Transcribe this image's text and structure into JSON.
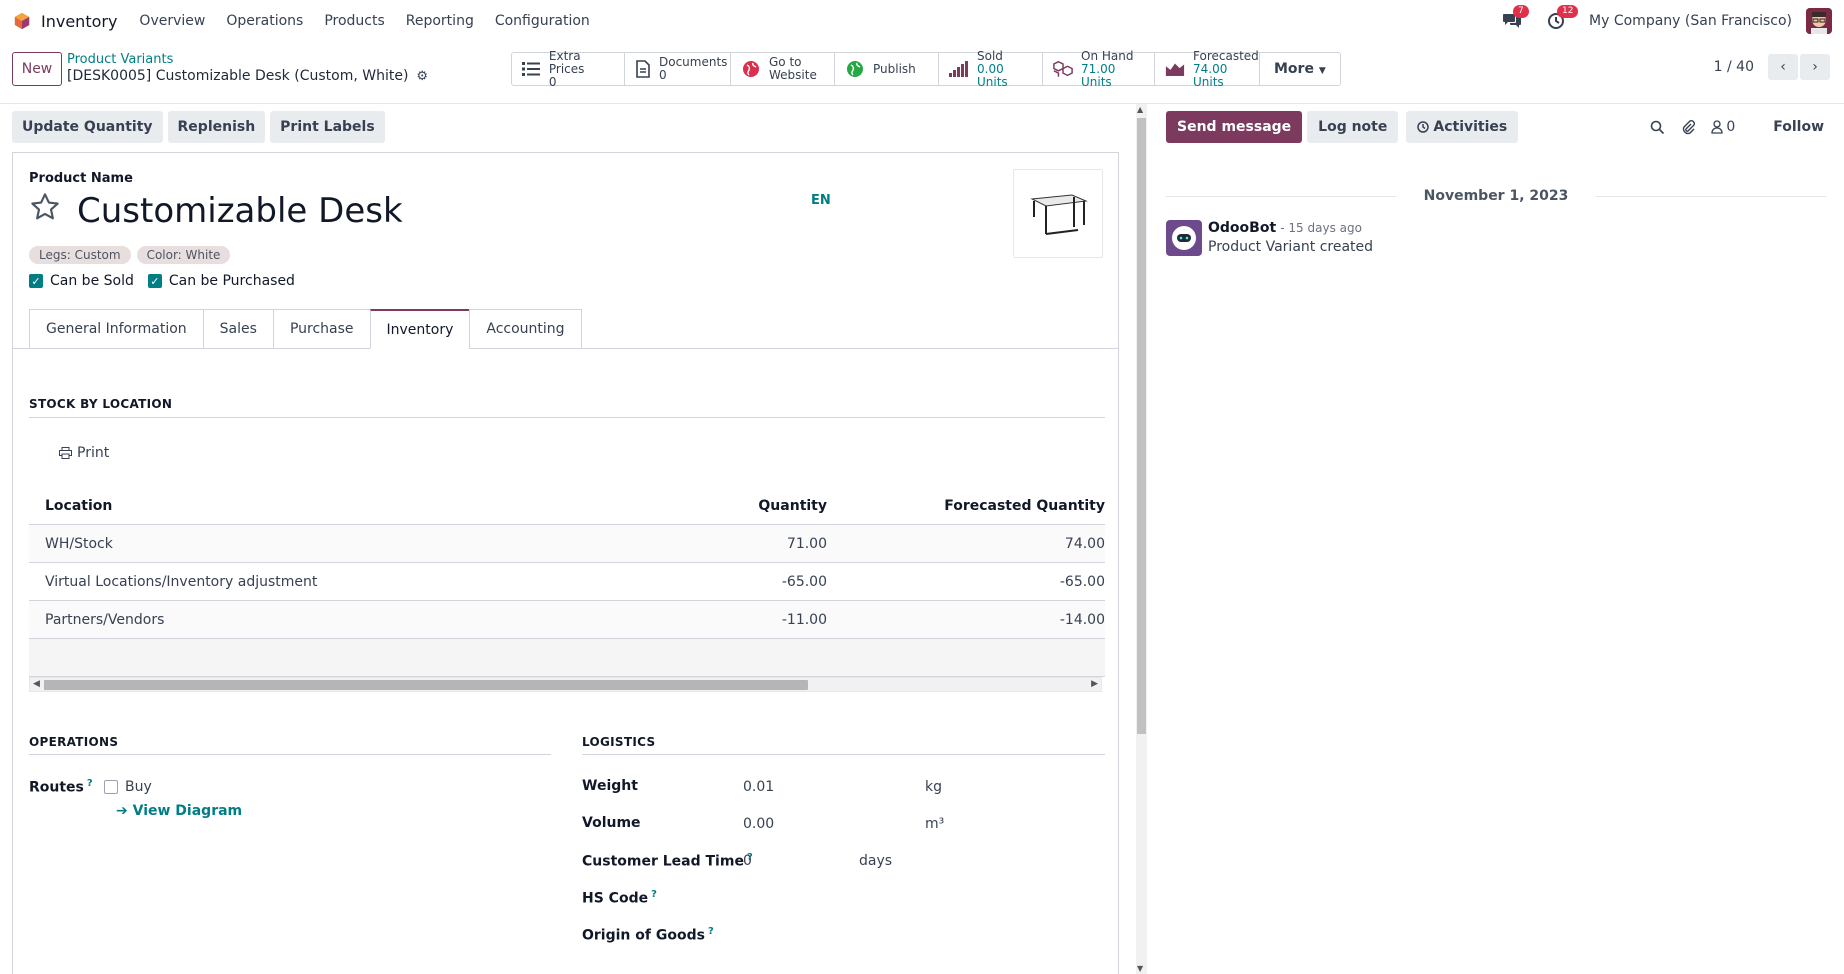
{
  "navbar": {
    "app_name": "Inventory",
    "menu": [
      "Overview",
      "Operations",
      "Products",
      "Reporting",
      "Configuration"
    ],
    "messages_badge": "7",
    "activities_badge": "12",
    "company": "My Company (San Francisco)"
  },
  "control": {
    "new_label": "New",
    "breadcrumb": "Product Variants",
    "record_title": "[DESK0005] Customizable Desk (Custom, White)",
    "stats": [
      {
        "label": "Extra Prices",
        "value": "0",
        "icon": "list-icon"
      },
      {
        "label": "Documents",
        "value": "0",
        "icon": "document-icon"
      },
      {
        "label": "Go to",
        "value": "Website",
        "icon": "globe-icon"
      },
      {
        "label": "Publish",
        "value": "",
        "icon": "globe-green-icon"
      },
      {
        "label": "Sold",
        "value": "0.00 Units",
        "icon": "signal-bars-icon"
      },
      {
        "label": "On Hand",
        "value": "71.00 Units",
        "icon": "cubes-icon"
      },
      {
        "label": "Forecasted",
        "value": "74.00 Units",
        "icon": "area-chart-icon"
      }
    ],
    "more_label": "More",
    "pager": "1 / 40"
  },
  "actions": [
    "Update Quantity",
    "Replenish",
    "Print Labels"
  ],
  "form": {
    "product_name_label": "Product Name",
    "product_name": "Customizable Desk",
    "lang": "EN",
    "tags": [
      "Legs: Custom",
      "Color: White"
    ],
    "can_be_sold": "Can be Sold",
    "can_be_purchased": "Can be Purchased",
    "tabs": [
      "General Information",
      "Sales",
      "Purchase",
      "Inventory",
      "Accounting"
    ],
    "active_tab": "Inventory",
    "stock_title": "STOCK BY LOCATION",
    "print_label": "Print",
    "table": {
      "headers": [
        "Location",
        "Quantity",
        "Forecasted Quantity"
      ],
      "rows": [
        [
          "WH/Stock",
          "71.00",
          "74.00"
        ],
        [
          "Virtual Locations/Inventory adjustment",
          "-65.00",
          "-65.00"
        ],
        [
          "Partners/Vendors",
          "-11.00",
          "-14.00"
        ]
      ]
    },
    "operations_title": "OPERATIONS",
    "routes_label": "Routes",
    "route_buy": "Buy",
    "view_diagram": "View Diagram",
    "logistics_title": "LOGISTICS",
    "weight_label": "Weight",
    "weight_value": "0.01",
    "weight_unit": "kg",
    "volume_label": "Volume",
    "volume_value": "0.00",
    "volume_unit": "m³",
    "lead_label": "Customer Lead Time",
    "lead_value": "0",
    "lead_unit": "days",
    "hs_label": "HS Code",
    "origin_label": "Origin of Goods"
  },
  "chatter": {
    "send_message": "Send message",
    "log_note": "Log note",
    "activities": "Activities",
    "followers_count": "0",
    "follow": "Follow",
    "date": "November 1, 2023",
    "message": {
      "author": "OdooBot",
      "time": "- 15 days ago",
      "body": "Product Variant created"
    }
  },
  "colors": {
    "brand": "#7c3a5e",
    "link": "#017e84",
    "badge": "#e0304a"
  }
}
